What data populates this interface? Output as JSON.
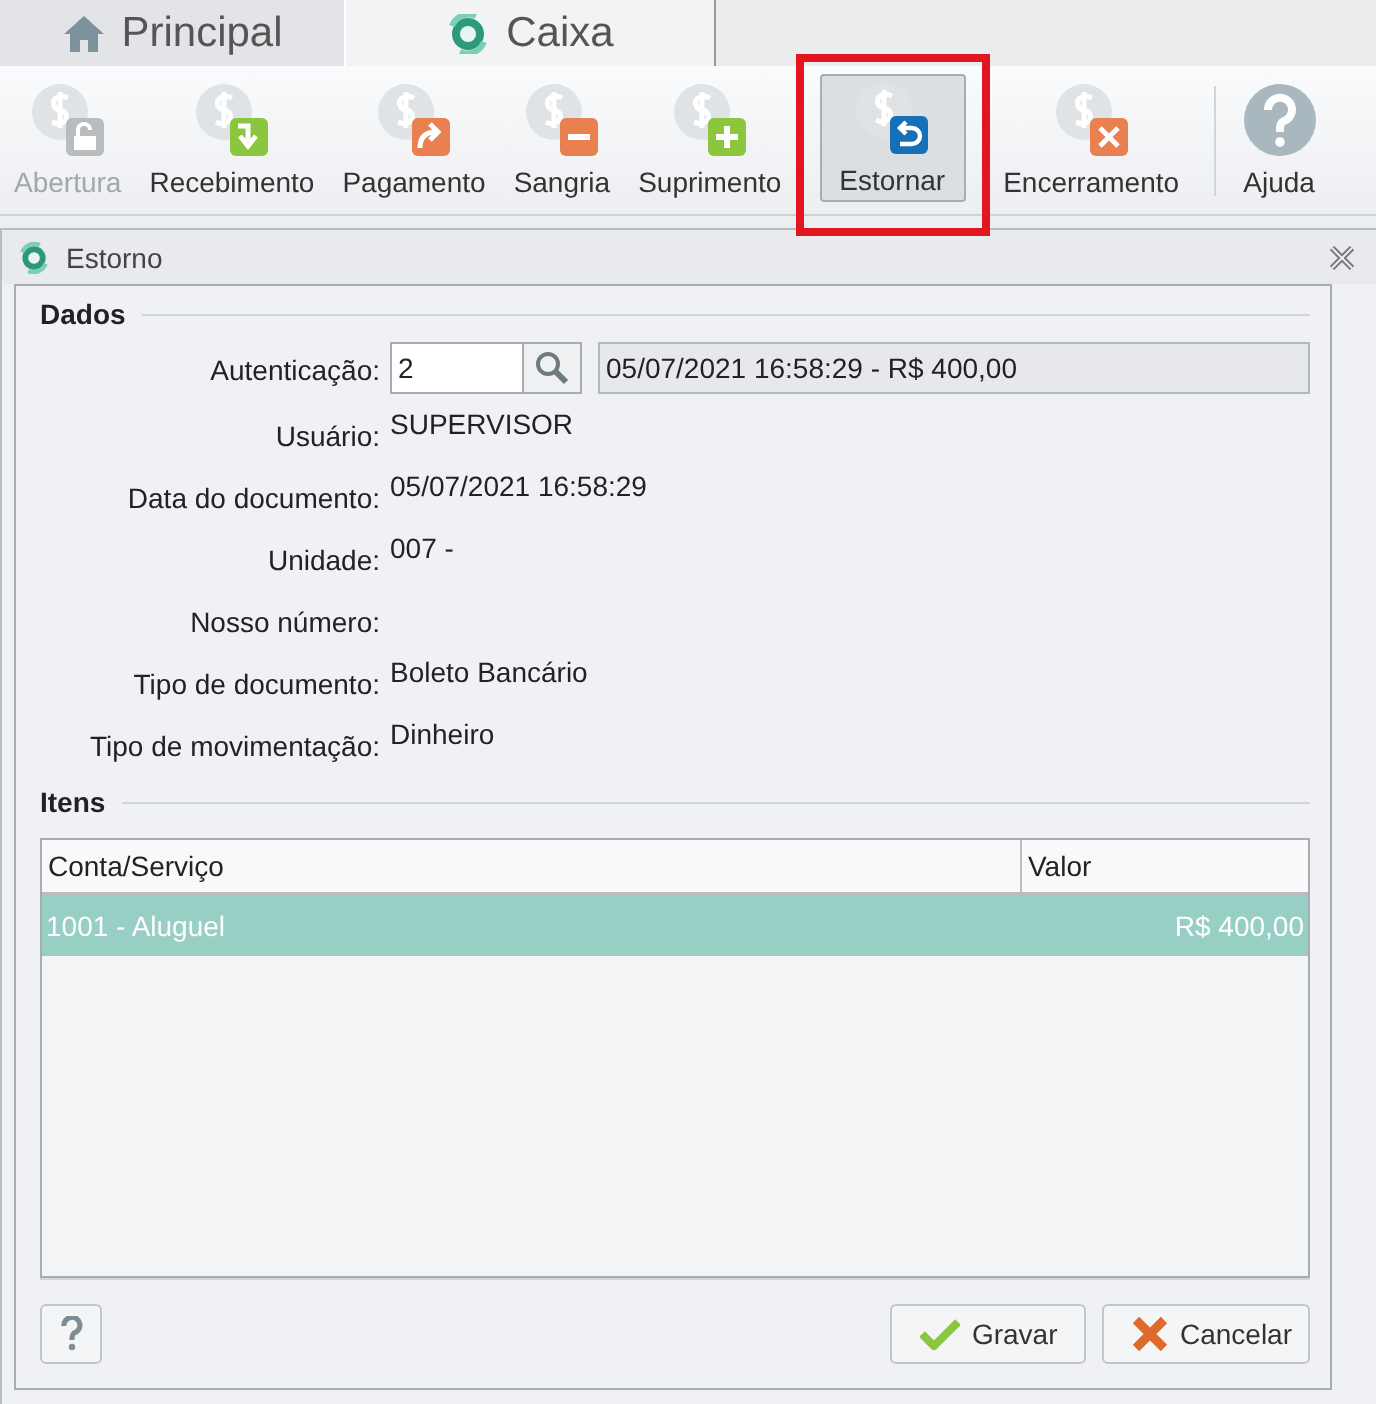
{
  "tabs": [
    {
      "label": "Principal",
      "kind": "home",
      "selected": false
    },
    {
      "label": "Caixa",
      "kind": "cash",
      "selected": true
    }
  ],
  "toolbar": [
    {
      "label": "Abertura",
      "kind": "lock",
      "disabled": true,
      "selected": false,
      "highlighted": false
    },
    {
      "label": "Recebimento",
      "kind": "down",
      "disabled": false,
      "selected": false,
      "highlighted": false
    },
    {
      "label": "Pagamento",
      "kind": "forward",
      "disabled": false,
      "selected": false,
      "highlighted": false
    },
    {
      "label": "Sangria",
      "kind": "minus",
      "disabled": false,
      "selected": false,
      "highlighted": false
    },
    {
      "label": "Suprimento",
      "kind": "plus",
      "disabled": false,
      "selected": false,
      "highlighted": false
    },
    {
      "label": "Estornar",
      "kind": "undo",
      "disabled": false,
      "selected": true,
      "highlighted": true
    },
    {
      "label": "Encerramento",
      "kind": "close",
      "disabled": false,
      "selected": false,
      "highlighted": false
    },
    {
      "label": "Ajuda",
      "kind": "help",
      "disabled": false,
      "selected": false,
      "highlighted": false
    }
  ],
  "dialog": {
    "title": "Estorno",
    "section_data": "Dados",
    "auth": {
      "label": "Autenticação:",
      "value": "2",
      "summary": "05/07/2021 16:58:29 - R$ 400,00"
    },
    "fields": [
      {
        "label": "Usuário:",
        "value": "SUPERVISOR"
      },
      {
        "label": "Data do documento:",
        "value": "05/07/2021 16:58:29"
      },
      {
        "label": "Unidade:",
        "value": "007 -"
      },
      {
        "label": "Nosso número:"
      },
      {
        "label": "Tipo de documento:",
        "value": "Boleto Bancário"
      },
      {
        "label": "Tipo de movimentação:",
        "value": "Dinheiro"
      }
    ],
    "section_items": "Itens",
    "table": {
      "columns": [
        "Conta/Serviço",
        "Valor"
      ],
      "rows": [
        {
          "cells": [
            "1001 - Aluguel",
            "R$ 400,00"
          ],
          "selected": true
        }
      ]
    },
    "buttons": [
      {
        "label": "Gravar",
        "kind": "save"
      },
      {
        "label": "Cancelar",
        "kind": "cancel"
      }
    ]
  }
}
